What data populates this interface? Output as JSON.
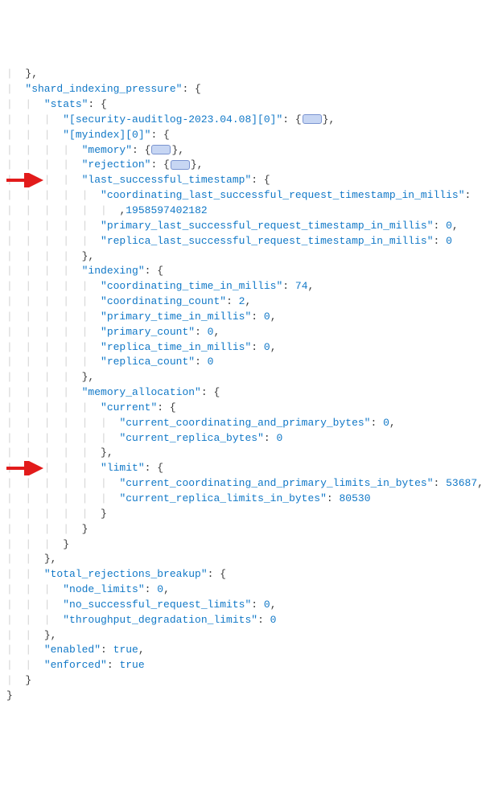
{
  "lines": {
    "l0": {
      "guide": "|  ",
      "text": "},",
      "cls": "punct"
    },
    "l1": {
      "guide": "|  ",
      "key": "\"shard_indexing_pressure\"",
      "after": ": {"
    },
    "l2": {
      "guide": "|  |  ",
      "key": "\"stats\"",
      "after": ": {"
    },
    "l3": {
      "guide": "|  |  |  ",
      "key": "\"[security-auditlog-2023.04.08][0]\"",
      "after_open": ": {",
      "badge": true,
      "after_close": "},"
    },
    "l4": {
      "guide": "|  |  |  ",
      "key": "\"[myindex][0]\"",
      "after": ": {"
    },
    "l5": {
      "guide": "|  |  |  |  ",
      "key": "\"memory\"",
      "after_open": ": {",
      "badge": true,
      "after_close": "},"
    },
    "l6": {
      "guide": "|  |  |  |  ",
      "key": "\"rejection\"",
      "after_open": ": {",
      "badge": true,
      "after_close": "},"
    },
    "l7": {
      "guide": "|  |  |  |  ",
      "key": "\"last_successful_timestamp\"",
      "after": ": {"
    },
    "l8": {
      "guide": "|  |  |  |  |  ",
      "key": "\"coordinating_last_successful_request_timestamp_in_millis\"",
      "after": ":"
    },
    "l8b": {
      "guide": "|  |  |  |  |  |  ",
      "num": "1958597402182",
      "after": ","
    },
    "l9": {
      "guide": "|  |  |  |  |  ",
      "key": "\"primary_last_successful_request_timestamp_in_millis\"",
      "after": ": ",
      "num": "0",
      "tail": ","
    },
    "l10": {
      "guide": "|  |  |  |  |  ",
      "key": "\"replica_last_successful_request_timestamp_in_millis\"",
      "after": ": ",
      "num": "0"
    },
    "l11": {
      "guide": "|  |  |  |  ",
      "text": "},",
      "cls": "punct"
    },
    "l12": {
      "guide": "|  |  |  |  ",
      "key": "\"indexing\"",
      "after": ": {"
    },
    "l13": {
      "guide": "|  |  |  |  |  ",
      "key": "\"coordinating_time_in_millis\"",
      "after": ": ",
      "num": "74",
      "tail": ","
    },
    "l14": {
      "guide": "|  |  |  |  |  ",
      "key": "\"coordinating_count\"",
      "after": ": ",
      "num": "2",
      "tail": ","
    },
    "l15": {
      "guide": "|  |  |  |  |  ",
      "key": "\"primary_time_in_millis\"",
      "after": ": ",
      "num": "0",
      "tail": ","
    },
    "l16": {
      "guide": "|  |  |  |  |  ",
      "key": "\"primary_count\"",
      "after": ": ",
      "num": "0",
      "tail": ","
    },
    "l17": {
      "guide": "|  |  |  |  |  ",
      "key": "\"replica_time_in_millis\"",
      "after": ": ",
      "num": "0",
      "tail": ","
    },
    "l18": {
      "guide": "|  |  |  |  |  ",
      "key": "\"replica_count\"",
      "after": ": ",
      "num": "0"
    },
    "l19": {
      "guide": "|  |  |  |  ",
      "text": "},",
      "cls": "punct"
    },
    "l20": {
      "guide": "|  |  |  |  ",
      "key": "\"memory_allocation\"",
      "after": ": {"
    },
    "l21": {
      "guide": "|  |  |  |  |  ",
      "key": "\"current\"",
      "after": ": {"
    },
    "l22": {
      "guide": "|  |  |  |  |  |  ",
      "key": "\"current_coordinating_and_primary_bytes\"",
      "after": ": ",
      "num": "0",
      "tail": ","
    },
    "l23": {
      "guide": "|  |  |  |  |  |  ",
      "key": "\"current_replica_bytes\"",
      "after": ": ",
      "num": "0"
    },
    "l24": {
      "guide": "|  |  |  |  |  ",
      "text": "},",
      "cls": "punct"
    },
    "l25": {
      "guide": "|  |  |  |  |  ",
      "key": "\"limit\"",
      "after": ": {"
    },
    "l26": {
      "guide": "|  |  |  |  |  |  ",
      "key": "\"current_coordinating_and_primary_limits_in_bytes\"",
      "after": ": ",
      "num": "53687",
      "tail": ","
    },
    "l27": {
      "guide": "|  |  |  |  |  |  ",
      "key": "\"current_replica_limits_in_bytes\"",
      "after": ": ",
      "num": "80530"
    },
    "l28": {
      "guide": "|  |  |  |  |  ",
      "text": "}",
      "cls": "punct"
    },
    "l29": {
      "guide": "|  |  |  |  ",
      "text": "}",
      "cls": "punct"
    },
    "l30": {
      "guide": "|  |  |  ",
      "text": "}",
      "cls": "punct"
    },
    "l31": {
      "guide": "|  |  ",
      "text": "},",
      "cls": "punct"
    },
    "l32": {
      "guide": "|  |  ",
      "key": "\"total_rejections_breakup\"",
      "after": ": {"
    },
    "l33": {
      "guide": "|  |  |  ",
      "key": "\"node_limits\"",
      "after": ": ",
      "num": "0",
      "tail": ","
    },
    "l34": {
      "guide": "|  |  |  ",
      "key": "\"no_successful_request_limits\"",
      "after": ": ",
      "num": "0",
      "tail": ","
    },
    "l35": {
      "guide": "|  |  |  ",
      "key": "\"throughput_degradation_limits\"",
      "after": ": ",
      "num": "0"
    },
    "l36": {
      "guide": "|  |  ",
      "text": "},",
      "cls": "punct"
    },
    "l37": {
      "guide": "|  |  ",
      "key": "\"enabled\"",
      "after": ": ",
      "bool": "true",
      "tail": ","
    },
    "l38": {
      "guide": "|  |  ",
      "key": "\"enforced\"",
      "after": ": ",
      "bool": "true"
    },
    "l39": {
      "guide": "|  ",
      "text": "}",
      "cls": "punct"
    },
    "l40": {
      "guide": "",
      "text": "}",
      "cls": "punct"
    }
  },
  "order": [
    "l0",
    "l1",
    "l2",
    "l3",
    "l4",
    "l5",
    "l6",
    "l7",
    "l8",
    "l8b",
    "l9",
    "l10",
    "l11",
    "l12",
    "l13",
    "l14",
    "l15",
    "l16",
    "l17",
    "l18",
    "l19",
    "l20",
    "l21",
    "l22",
    "l23",
    "l24",
    "l25",
    "l26",
    "l27",
    "l28",
    "l29",
    "l30",
    "l31",
    "l32",
    "l33",
    "l34",
    "l35",
    "l36",
    "l37",
    "l38",
    "l39",
    "l40"
  ],
  "arrows": [
    {
      "target": "l7"
    },
    {
      "target": "l25"
    }
  ]
}
